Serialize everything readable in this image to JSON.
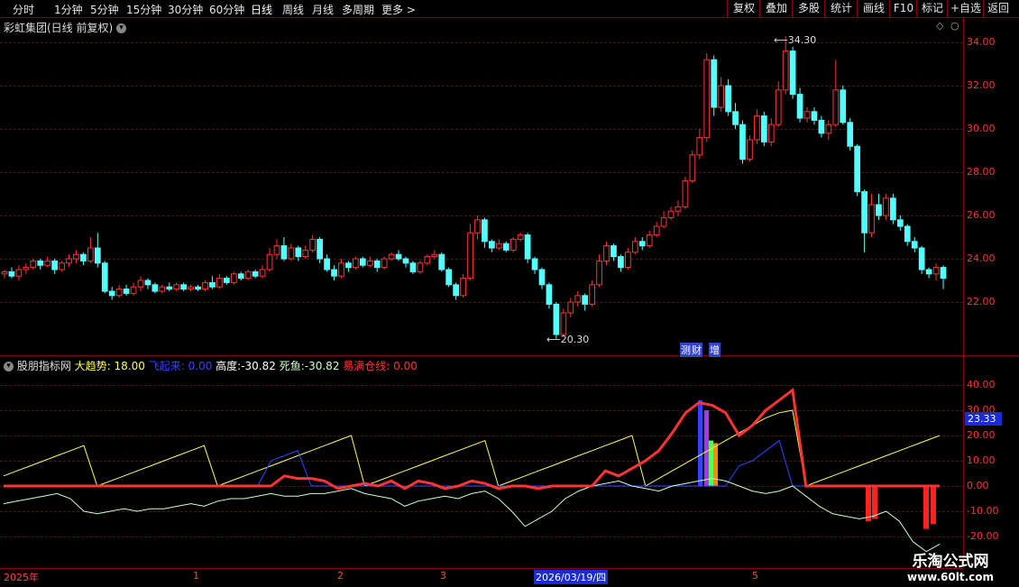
{
  "toolbar": {
    "periods": [
      "分时",
      "1分钟",
      "5分钟",
      "15分钟",
      "30分钟",
      "60分钟",
      "日线",
      "周线",
      "月线",
      "多周期",
      "更多"
    ],
    "active": "日线",
    "right_buttons": [
      "复权",
      "叠加",
      "多股",
      "统计",
      "画线",
      "F10",
      "标记",
      "+自选",
      "返回"
    ]
  },
  "price_panel": {
    "title": "彩虹集团(日线 前复权)",
    "high_label": "34.30",
    "low_label": "20.30",
    "events": [
      "测",
      "财",
      "增"
    ],
    "yticks": [
      "34.00",
      "32.00",
      "30.00",
      "28.00",
      "26.00",
      "24.00",
      "22.00"
    ]
  },
  "indicator_panel": {
    "name": "股朋指标网",
    "items": [
      {
        "label": "大趋势:",
        "value": "18.00",
        "color": "#ffff55"
      },
      {
        "label": "飞起来:",
        "value": "0.00",
        "color": "#3344ff"
      },
      {
        "label": "高度:",
        "value": "-30.82",
        "color": "#ffffff"
      },
      {
        "label": "死鱼:",
        "value": "-30.82",
        "color": "#ccffcc"
      },
      {
        "label": "易满仓线:",
        "value": "0.00",
        "color": "#ff3333"
      }
    ],
    "yticks": [
      "40.00",
      "30.00",
      "20.00",
      "10.00",
      "0.00",
      "-10.00",
      "-20.00"
    ],
    "cursor_value": "23.33"
  },
  "date_axis": {
    "labels": [
      "2025年",
      "1",
      "2",
      "3",
      "2026/03/19/四",
      "5"
    ]
  },
  "watermark": {
    "line1": "乐淘公式网",
    "line2": "www.60lt.com"
  },
  "colors": {
    "up": "#ff3333",
    "down": "#54ffff",
    "grid": "#8b0000"
  },
  "chart_data": [
    {
      "type": "candlestick",
      "title": "彩虹集团(日线 前复权)",
      "ylim": [
        20,
        35
      ],
      "annotations": [
        {
          "text": "34.30",
          "value": 34.3
        },
        {
          "text": "20.30",
          "value": 20.3
        }
      ],
      "candles": [
        [
          23.3,
          23.4,
          23.1,
          23.5
        ],
        [
          23.4,
          23.2,
          23.1,
          23.6
        ],
        [
          23.2,
          23.5,
          23.0,
          23.7
        ],
        [
          23.5,
          23.6,
          23.3,
          23.8
        ],
        [
          23.6,
          23.9,
          23.5,
          24.0
        ],
        [
          23.9,
          23.7,
          23.5,
          24.0
        ],
        [
          23.7,
          23.9,
          23.6,
          24.1
        ],
        [
          23.9,
          23.5,
          23.3,
          24.0
        ],
        [
          23.5,
          23.8,
          23.4,
          23.9
        ],
        [
          23.8,
          24.0,
          23.6,
          24.2
        ],
        [
          24.0,
          24.2,
          23.8,
          24.4
        ],
        [
          24.2,
          23.9,
          23.7,
          24.3
        ],
        [
          23.9,
          24.5,
          23.8,
          25.0
        ],
        [
          24.5,
          23.8,
          23.6,
          25.2
        ],
        [
          23.8,
          22.5,
          22.4,
          23.9
        ],
        [
          22.5,
          22.3,
          22.1,
          22.7
        ],
        [
          22.3,
          22.6,
          22.2,
          22.8
        ],
        [
          22.6,
          22.4,
          22.3,
          22.8
        ],
        [
          22.4,
          22.7,
          22.3,
          22.9
        ],
        [
          22.7,
          23.0,
          22.5,
          23.2
        ],
        [
          23.0,
          22.8,
          22.6,
          23.1
        ],
        [
          22.8,
          22.5,
          22.4,
          22.9
        ],
        [
          22.5,
          22.7,
          22.4,
          22.8
        ],
        [
          22.7,
          22.6,
          22.5,
          22.9
        ],
        [
          22.6,
          22.8,
          22.5,
          22.9
        ],
        [
          22.8,
          22.6,
          22.5,
          22.9
        ],
        [
          22.6,
          22.7,
          22.5,
          22.8
        ],
        [
          22.7,
          22.6,
          22.5,
          22.8
        ],
        [
          22.6,
          22.9,
          22.5,
          23.0
        ],
        [
          22.9,
          22.7,
          22.6,
          23.2
        ],
        [
          22.7,
          23.1,
          22.6,
          23.3
        ],
        [
          23.1,
          22.9,
          22.8,
          23.2
        ],
        [
          22.9,
          23.3,
          22.8,
          23.4
        ],
        [
          23.3,
          23.1,
          23.0,
          23.4
        ],
        [
          23.1,
          23.4,
          23.0,
          23.5
        ],
        [
          23.4,
          23.2,
          23.1,
          23.5
        ],
        [
          23.2,
          23.5,
          23.1,
          23.7
        ],
        [
          23.5,
          24.2,
          23.4,
          24.5
        ],
        [
          24.2,
          24.6,
          24.0,
          24.9
        ],
        [
          24.6,
          24.0,
          23.9,
          25.0
        ],
        [
          24.0,
          24.5,
          23.9,
          24.7
        ],
        [
          24.5,
          24.1,
          23.9,
          24.6
        ],
        [
          24.1,
          24.4,
          24.0,
          24.6
        ],
        [
          24.4,
          24.9,
          24.3,
          25.1
        ],
        [
          24.9,
          24.0,
          23.8,
          25.0
        ],
        [
          24.0,
          23.5,
          23.4,
          24.2
        ],
        [
          23.5,
          23.2,
          23.0,
          23.7
        ],
        [
          23.2,
          23.8,
          23.1,
          24.0
        ],
        [
          23.8,
          23.6,
          23.4,
          23.9
        ],
        [
          23.6,
          24.0,
          23.5,
          24.1
        ],
        [
          24.0,
          23.7,
          23.6,
          24.1
        ],
        [
          23.7,
          23.9,
          23.6,
          24.1
        ],
        [
          23.9,
          23.6,
          23.4,
          24.0
        ],
        [
          23.6,
          24.0,
          23.5,
          24.1
        ],
        [
          24.0,
          24.2,
          23.9,
          24.3
        ],
        [
          24.2,
          24.0,
          23.9,
          24.4
        ],
        [
          24.0,
          23.8,
          23.6,
          24.1
        ],
        [
          23.8,
          23.4,
          23.3,
          23.9
        ],
        [
          23.4,
          23.8,
          23.3,
          23.9
        ],
        [
          23.8,
          24.1,
          23.7,
          24.2
        ],
        [
          24.1,
          24.2,
          24.0,
          24.4
        ],
        [
          24.2,
          23.5,
          23.4,
          24.3
        ],
        [
          23.5,
          22.8,
          22.7,
          23.6
        ],
        [
          22.8,
          22.3,
          22.1,
          22.9
        ],
        [
          22.3,
          23.1,
          22.2,
          23.3
        ],
        [
          23.1,
          25.2,
          23.0,
          25.6
        ],
        [
          25.2,
          25.8,
          24.9,
          26.0
        ],
        [
          25.8,
          24.8,
          24.5,
          25.9
        ],
        [
          24.8,
          24.5,
          24.3,
          24.9
        ],
        [
          24.5,
          24.7,
          24.4,
          24.9
        ],
        [
          24.7,
          24.4,
          24.3,
          24.8
        ],
        [
          24.4,
          24.9,
          24.3,
          25.0
        ],
        [
          24.9,
          25.1,
          24.8,
          25.2
        ],
        [
          25.1,
          24.0,
          23.8,
          25.2
        ],
        [
          24.0,
          23.5,
          23.3,
          24.1
        ],
        [
          23.5,
          22.8,
          22.6,
          23.6
        ],
        [
          22.8,
          21.9,
          21.7,
          22.9
        ],
        [
          21.9,
          20.5,
          20.3,
          22.0
        ],
        [
          20.5,
          21.5,
          20.4,
          21.7
        ],
        [
          21.5,
          22.0,
          21.3,
          22.2
        ],
        [
          22.0,
          22.3,
          21.8,
          22.5
        ],
        [
          22.3,
          21.9,
          21.6,
          22.4
        ],
        [
          21.9,
          22.8,
          21.8,
          23.0
        ],
        [
          22.8,
          23.9,
          22.7,
          24.2
        ],
        [
          23.9,
          24.6,
          23.7,
          24.8
        ],
        [
          24.6,
          24.1,
          23.9,
          24.7
        ],
        [
          24.1,
          23.6,
          23.4,
          24.2
        ],
        [
          23.6,
          24.3,
          23.5,
          24.5
        ],
        [
          24.3,
          24.8,
          24.2,
          25.0
        ],
        [
          24.8,
          24.6,
          24.4,
          25.0
        ],
        [
          24.6,
          25.1,
          24.5,
          25.3
        ],
        [
          25.1,
          25.5,
          25.0,
          25.7
        ],
        [
          25.5,
          25.9,
          25.4,
          26.2
        ],
        [
          25.9,
          26.2,
          25.8,
          26.4
        ],
        [
          26.2,
          26.4,
          26.0,
          26.7
        ],
        [
          26.4,
          27.6,
          26.3,
          27.8
        ],
        [
          27.6,
          28.8,
          27.5,
          29.0
        ],
        [
          28.8,
          29.6,
          28.6,
          30.0
        ],
        [
          29.6,
          33.2,
          29.4,
          33.5
        ],
        [
          33.2,
          31.0,
          30.6,
          33.4
        ],
        [
          31.0,
          32.0,
          30.8,
          32.4
        ],
        [
          32.0,
          30.8,
          30.6,
          32.3
        ],
        [
          30.8,
          30.2,
          30.0,
          31.2
        ],
        [
          30.2,
          28.6,
          28.4,
          30.4
        ],
        [
          28.6,
          29.5,
          28.5,
          29.7
        ],
        [
          29.5,
          30.6,
          29.3,
          30.9
        ],
        [
          30.6,
          29.4,
          29.2,
          30.8
        ],
        [
          29.4,
          30.2,
          29.2,
          30.5
        ],
        [
          30.2,
          31.8,
          30.1,
          32.2
        ],
        [
          31.8,
          33.6,
          31.6,
          34.3
        ],
        [
          33.6,
          31.6,
          31.4,
          33.8
        ],
        [
          31.6,
          30.5,
          30.3,
          31.9
        ],
        [
          30.5,
          30.8,
          30.3,
          31.0
        ],
        [
          30.8,
          30.4,
          30.2,
          31.0
        ],
        [
          30.4,
          29.8,
          29.6,
          30.6
        ],
        [
          29.8,
          30.2,
          29.5,
          30.4
        ],
        [
          30.2,
          31.8,
          30.1,
          33.2
        ],
        [
          31.8,
          30.3,
          30.2,
          32.0
        ],
        [
          30.3,
          29.2,
          29.0,
          30.5
        ],
        [
          29.2,
          27.1,
          26.9,
          29.3
        ],
        [
          27.1,
          25.2,
          24.3,
          27.2
        ],
        [
          25.2,
          26.5,
          25.0,
          27.0
        ],
        [
          26.5,
          26.0,
          25.8,
          27.0
        ],
        [
          26.0,
          26.8,
          25.8,
          27.0
        ],
        [
          26.8,
          25.8,
          25.6,
          27.0
        ],
        [
          25.8,
          25.5,
          25.3,
          26.0
        ],
        [
          25.5,
          24.8,
          24.6,
          25.6
        ],
        [
          24.8,
          24.5,
          24.3,
          25.0
        ],
        [
          24.5,
          23.5,
          23.3,
          24.6
        ],
        [
          23.5,
          23.3,
          23.1,
          23.6
        ],
        [
          23.3,
          23.6,
          23.0,
          23.8
        ],
        [
          23.6,
          23.1,
          22.6,
          23.7
        ]
      ]
    },
    {
      "type": "line",
      "series": [
        {
          "name": "大趋势",
          "color": "#ffff55",
          "values": [
            4,
            6,
            8,
            10,
            12,
            14,
            16,
            0,
            2,
            4,
            6,
            8,
            10,
            12,
            14,
            16,
            0,
            2,
            4,
            6,
            8,
            10,
            12,
            14,
            16,
            18,
            20,
            0,
            2,
            4,
            6,
            8,
            10,
            12,
            14,
            16,
            18,
            0,
            2,
            4,
            6,
            8,
            10,
            12,
            14,
            16,
            18,
            20,
            0,
            3,
            6,
            9,
            12,
            15,
            18,
            21,
            24,
            27,
            29,
            30,
            0,
            2,
            4,
            6,
            8,
            10,
            12,
            14,
            16,
            18,
            20
          ]
        },
        {
          "name": "飞起来",
          "color": "#3344ff",
          "values": [
            0,
            0,
            0,
            0,
            0,
            0,
            0,
            0,
            0,
            0,
            0,
            0,
            0,
            0,
            0,
            0,
            0,
            0,
            0,
            0,
            10,
            12,
            14,
            0,
            0,
            0,
            0,
            0,
            0,
            0,
            0,
            0,
            0,
            0,
            0,
            0,
            0,
            0,
            0,
            0,
            0,
            0,
            0,
            0,
            0,
            0,
            0,
            0,
            0,
            0,
            0,
            0,
            0,
            0,
            0,
            8,
            10,
            14,
            18,
            0,
            0,
            0,
            0,
            0,
            0,
            0,
            0,
            0,
            0,
            0,
            0
          ]
        },
        {
          "name": "死鱼",
          "color": "#ccffcc",
          "values": [
            -7,
            -6,
            -5,
            -4,
            -3,
            -5,
            -10,
            -11,
            -10,
            -9,
            -10,
            -9,
            -9,
            -8,
            -7,
            -8,
            -6,
            -5,
            -5,
            -4,
            -3,
            -4,
            -4,
            -3,
            -3,
            -2,
            -1,
            -3,
            -4,
            -5,
            -8,
            -6,
            -5,
            -4,
            -5,
            -3,
            -2,
            -5,
            -10,
            -16,
            -13,
            -10,
            -5,
            -2,
            0,
            1,
            2,
            0,
            -1,
            -2,
            0,
            1,
            2,
            3,
            2,
            0,
            -2,
            -3,
            -2,
            0,
            -4,
            -8,
            -11,
            -12,
            -13,
            -12,
            -10,
            -14,
            -22,
            -26,
            -23
          ]
        },
        {
          "name": "易满仓线",
          "color": "#ff3333",
          "values": [
            0,
            0,
            0,
            0,
            0,
            0,
            0,
            0,
            0,
            0,
            0,
            0,
            0,
            0,
            0,
            0,
            0,
            0,
            0,
            0,
            0,
            4,
            3,
            3,
            2,
            -1,
            0,
            1,
            0,
            2,
            -1,
            2,
            1,
            -1,
            0,
            2,
            1,
            -1,
            0,
            0,
            -1,
            0,
            0,
            0,
            0,
            6,
            4,
            7,
            10,
            14,
            21,
            29,
            33,
            32,
            29,
            20,
            24,
            30,
            34,
            38,
            0,
            0,
            0,
            0,
            0,
            0,
            0,
            0,
            0,
            0,
            0
          ]
        }
      ],
      "bars_red": [
        -14,
        -13,
        -17,
        -15
      ],
      "ylim": [
        -20,
        40
      ]
    }
  ]
}
